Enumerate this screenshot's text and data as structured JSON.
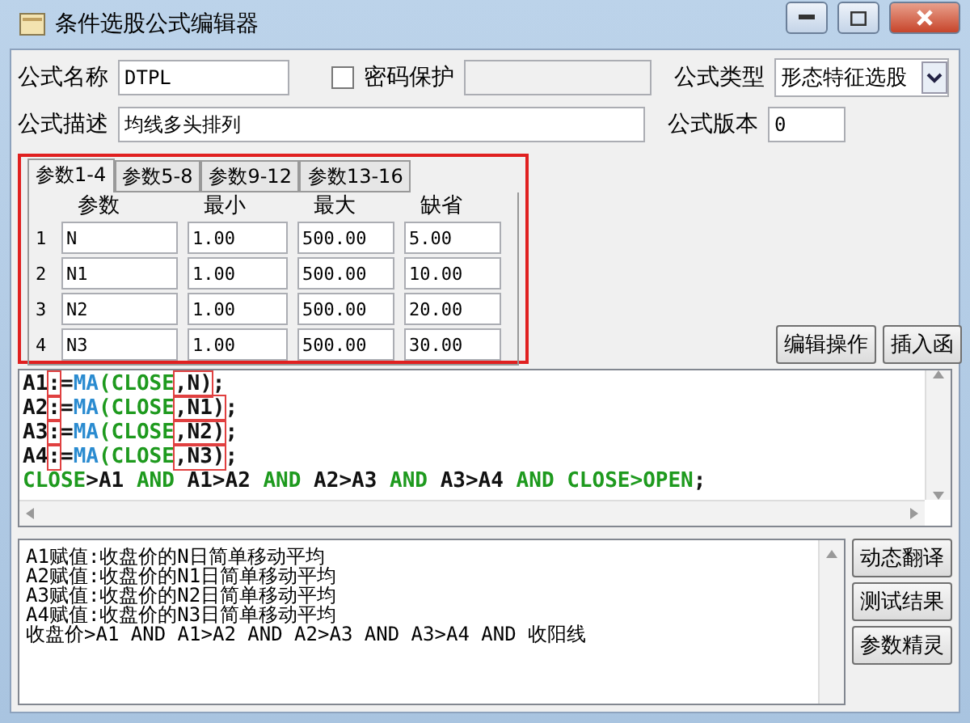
{
  "window": {
    "title": "条件选股公式编辑器"
  },
  "form": {
    "name_label": "公式名称",
    "name_value": "DTPL",
    "password": {
      "label": "密码保护",
      "checked": false
    },
    "type_label": "公式类型",
    "type_value": "形态特征选股",
    "desc_label": "公式描述",
    "desc_value": "均线多头排列",
    "version_label": "公式版本",
    "version_value": "0"
  },
  "param_tabs": [
    {
      "label": "参数1-4",
      "selected": true
    },
    {
      "label": "参数5-8",
      "selected": false
    },
    {
      "label": "参数9-12",
      "selected": false
    },
    {
      "label": "参数13-16",
      "selected": false
    }
  ],
  "param_panel": {
    "highlighted": true,
    "columns": [
      "参数",
      "最小",
      "最大",
      "缺省"
    ],
    "rows": [
      {
        "index": "1",
        "cells": [
          "N",
          "1.00",
          "500.00",
          "5.00"
        ]
      },
      {
        "index": "2",
        "cells": [
          "N1",
          "1.00",
          "500.00",
          "10.00"
        ]
      },
      {
        "index": "3",
        "cells": [
          "N2",
          "1.00",
          "500.00",
          "20.00"
        ]
      },
      {
        "index": "4",
        "cells": [
          "N3",
          "1.00",
          "500.00",
          "30.00"
        ]
      }
    ]
  },
  "buttons": [
    "编辑操作",
    "插入函"
  ],
  "code_lines": [
    [
      {
        "text": "A1",
        "kind": "plain"
      },
      {
        "text": ":",
        "kind": "plain",
        "marked": true
      },
      {
        "text": "=",
        "kind": "plain"
      },
      {
        "text": "MA",
        "kind": "func"
      },
      {
        "text": "(CLOSE",
        "kind": "keyword"
      },
      {
        "text": ",N)",
        "kind": "plain",
        "marked": true
      },
      {
        "text": ";",
        "kind": "plain"
      }
    ],
    [
      {
        "text": "A2",
        "kind": "plain"
      },
      {
        "text": ":",
        "kind": "plain",
        "marked": true
      },
      {
        "text": "=",
        "kind": "plain"
      },
      {
        "text": "MA",
        "kind": "func"
      },
      {
        "text": "(CLOSE",
        "kind": "keyword"
      },
      {
        "text": ",N1)",
        "kind": "plain",
        "marked": true
      },
      {
        "text": ";",
        "kind": "plain"
      }
    ],
    [
      {
        "text": "A3",
        "kind": "plain"
      },
      {
        "text": ":",
        "kind": "plain",
        "marked": true
      },
      {
        "text": "=",
        "kind": "plain"
      },
      {
        "text": "MA",
        "kind": "func"
      },
      {
        "text": "(CLOSE",
        "kind": "keyword"
      },
      {
        "text": ",N2)",
        "kind": "plain",
        "marked": true
      },
      {
        "text": ";",
        "kind": "plain"
      }
    ],
    [
      {
        "text": "A4",
        "kind": "plain"
      },
      {
        "text": ":",
        "kind": "plain",
        "marked": true
      },
      {
        "text": "=",
        "kind": "plain"
      },
      {
        "text": "MA",
        "kind": "func"
      },
      {
        "text": "(CLOSE",
        "kind": "keyword"
      },
      {
        "text": ",N3)",
        "kind": "plain",
        "marked": true
      },
      {
        "text": ";",
        "kind": "plain"
      }
    ],
    [
      {
        "text": "CLOSE",
        "kind": "keyword"
      },
      {
        "text": ">A1 ",
        "kind": "plain"
      },
      {
        "text": "AND",
        "kind": "keyword"
      },
      {
        "text": " A1>A2 ",
        "kind": "plain"
      },
      {
        "text": "AND",
        "kind": "keyword"
      },
      {
        "text": " A2>A3 ",
        "kind": "plain"
      },
      {
        "text": "AND",
        "kind": "keyword"
      },
      {
        "text": " A3>A4 ",
        "kind": "plain"
      },
      {
        "text": "AND",
        "kind": "keyword"
      },
      {
        "text": " CLOSE>",
        "kind": "keyword"
      },
      {
        "text": "OPEN",
        "kind": "keyword"
      },
      {
        "text": ";",
        "kind": "plain"
      }
    ]
  ],
  "translation_lines": [
    "A1赋值:收盘价的N日简单移动平均",
    "A2赋值:收盘价的N1日简单移动平均",
    "A3赋值:收盘价的N2日简单移动平均",
    "A4赋值:收盘价的N3日简单移动平均",
    "收盘价>A1 AND A1>A2 AND A2>A3 AND A3>A4 AND 收阳线"
  ],
  "side_buttons": [
    "动态翻译",
    "测试结果",
    "参数精灵"
  ]
}
